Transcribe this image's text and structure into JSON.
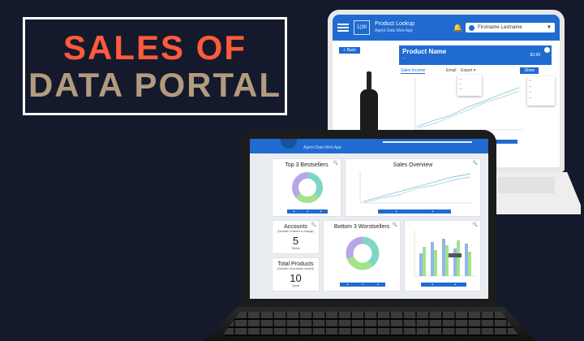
{
  "title": {
    "line1": "SALES OF",
    "line2": "DATA PORTAL"
  },
  "colors": {
    "background": "#141a2c",
    "title_line1": "#ff5a3c",
    "title_line2": "#b39b7e",
    "app_blue": "#1f6bd0"
  },
  "back_app": {
    "logo": "1(30",
    "app_name": "Product Lookup",
    "app_subtitle": "Agent Data Web App",
    "user_name": "Firstname Lastname",
    "back_label": "< Back",
    "product_name": "Product Name",
    "price": "$3.99",
    "tabs": [
      "Sales Income",
      "Email",
      "Export ▾",
      "Show"
    ]
  },
  "front_app": {
    "app_subtitle": "Agent Data Web App",
    "top_bestsellers": {
      "title": "Top 3 Bestsellers"
    },
    "sales_overview": {
      "title": "Sales Overview"
    },
    "accounts": {
      "title": "Accounts",
      "subtitle": "(Number of stores in charge)",
      "value": "5",
      "unit": "Stores"
    },
    "total_products": {
      "title": "Total Products",
      "subtitle": "(Number of products carried)",
      "value": "10",
      "unit": "Types"
    },
    "bottom_worstsellers": {
      "title": "Bottom 3 Worstsellers"
    }
  },
  "icons": {
    "menu": "menu-icon",
    "bell": "bell-icon",
    "zoom": "zoom-icon"
  }
}
